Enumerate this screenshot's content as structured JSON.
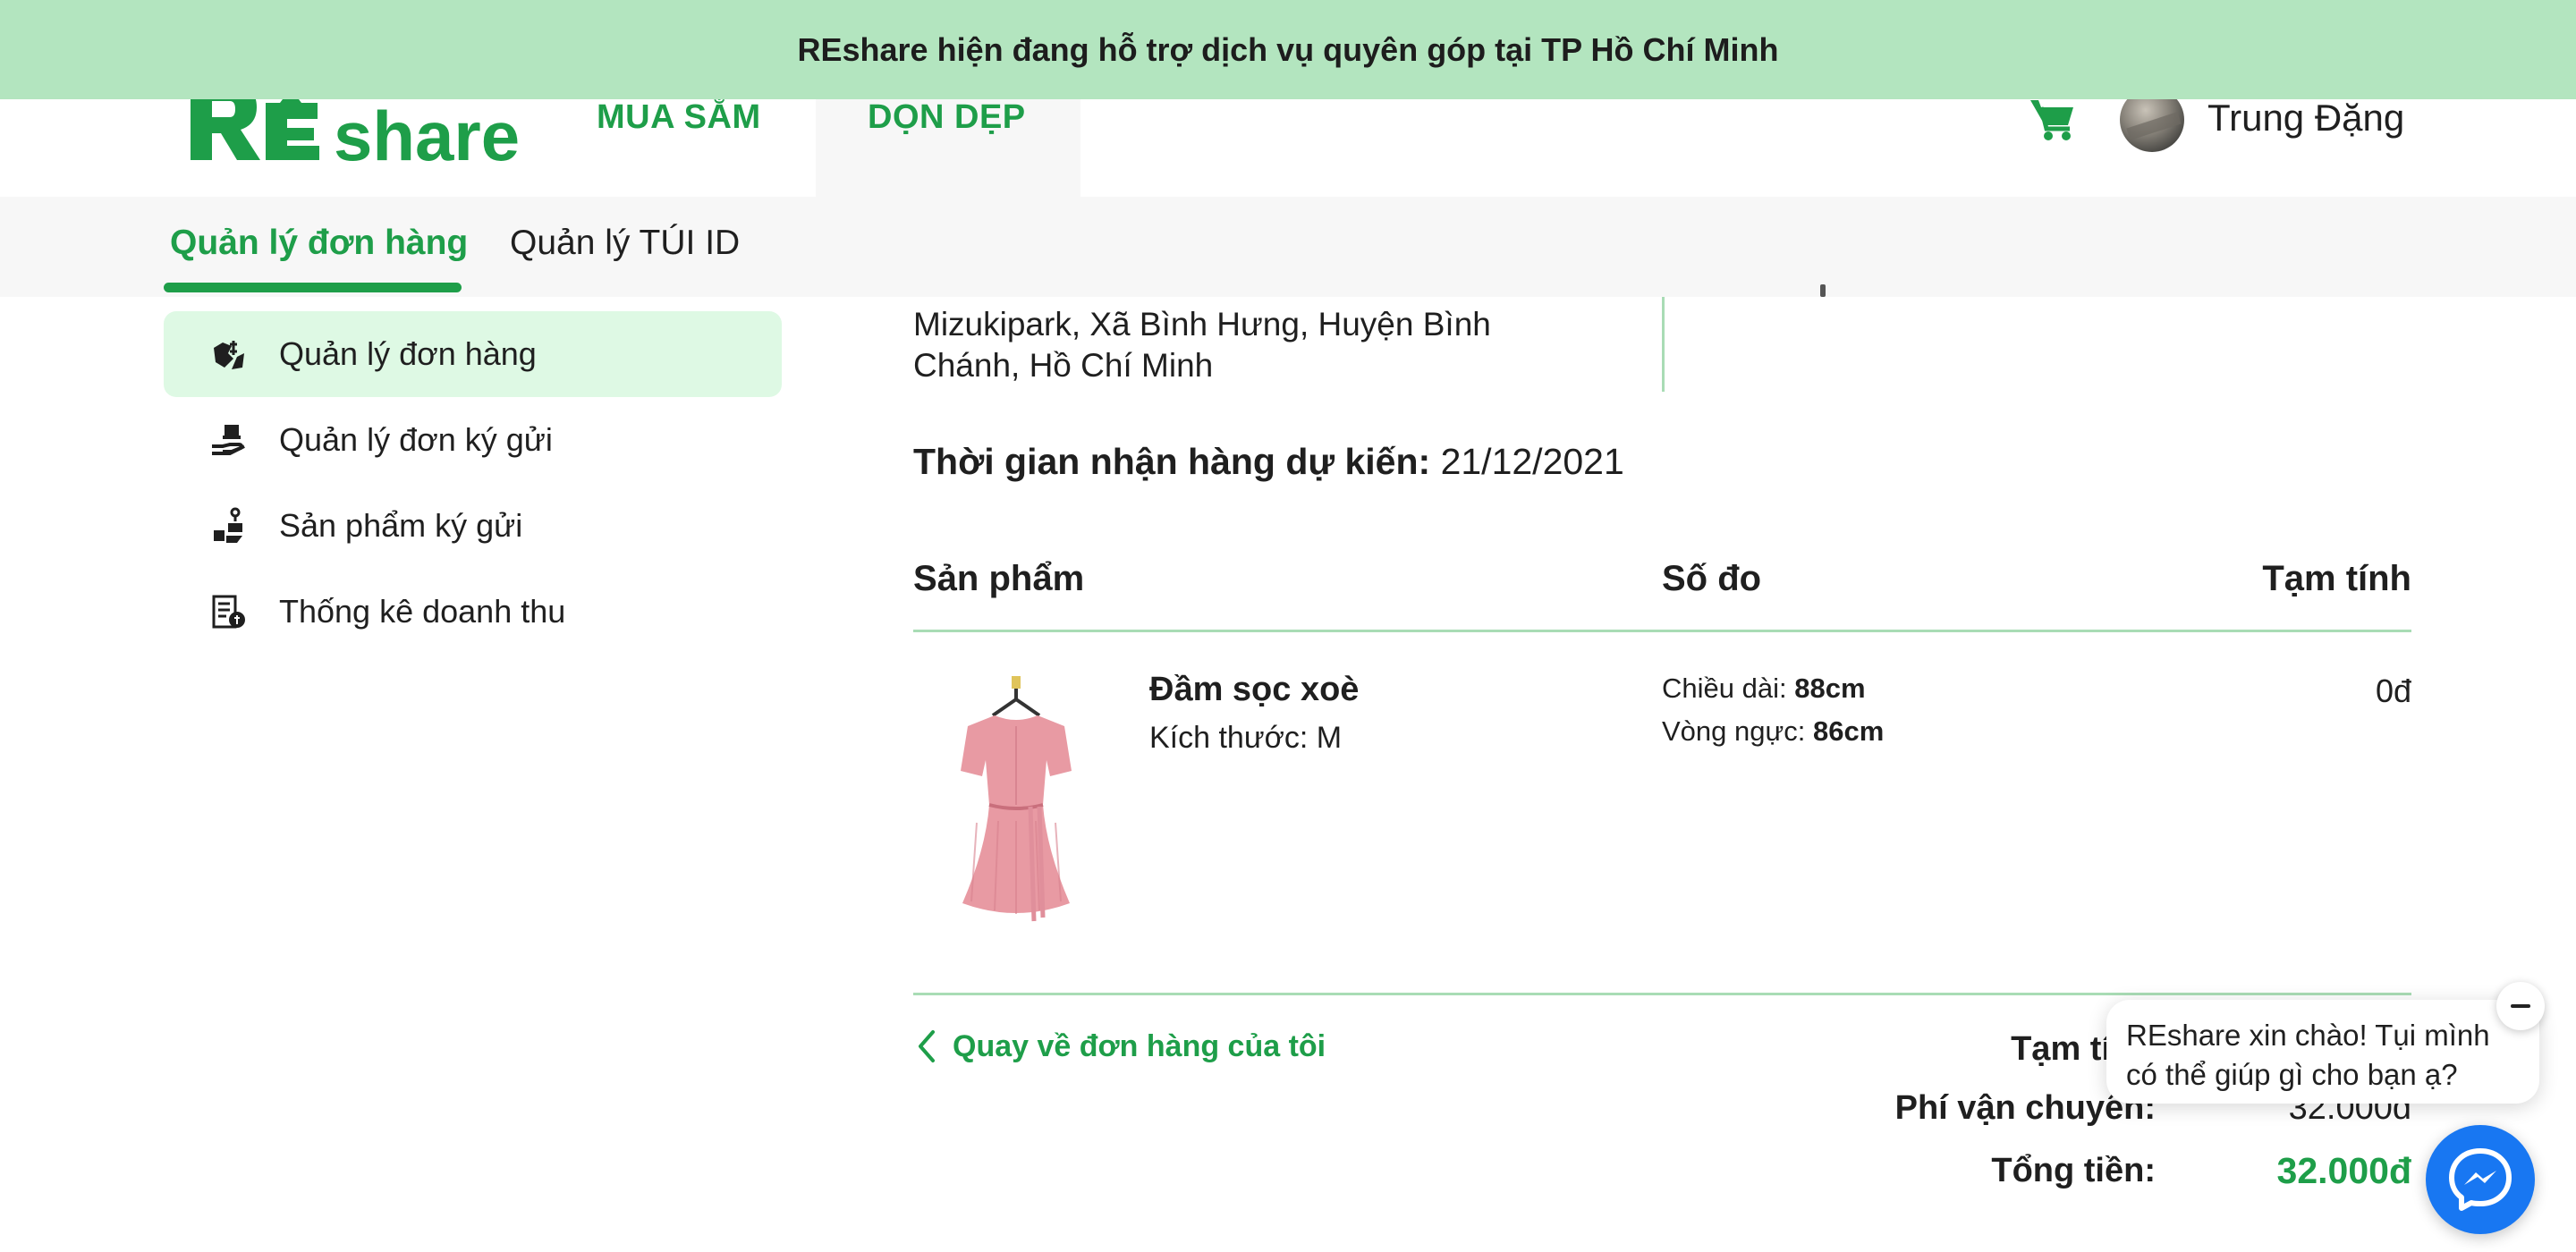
{
  "banner": {
    "text": "REshare hiện đang hỗ trợ dịch vụ quyên góp tại TP Hồ Chí Minh"
  },
  "header": {
    "logo_alt": "REshare",
    "nav": {
      "shop": "MUA SẮM",
      "clean": "DỌN DẸP"
    },
    "cart_icon": "cart-icon",
    "user_name": "Trung Đặng"
  },
  "subnav": {
    "orders": "Quản lý đơn hàng",
    "bags": "Quản lý TÚI ID"
  },
  "sidebar": {
    "items": [
      {
        "label": "Quản lý đơn hàng",
        "icon": "order-hand-icon",
        "active": true
      },
      {
        "label": "Quản lý đơn ký gửi",
        "icon": "consign-hand-icon",
        "active": false
      },
      {
        "label": "Sản phẩm ký gửi",
        "icon": "consign-product-icon",
        "active": false
      },
      {
        "label": "Thống kê doanh thu",
        "icon": "revenue-stats-icon",
        "active": false
      }
    ]
  },
  "order": {
    "address_line1": "Mizukipark, Xã Bình Hưng, Huyện Bình",
    "address_line2": "Chánh, Hồ Chí Minh",
    "eta_label": "Thời gian nhận hàng dự kiến:",
    "eta_value": "21/12/2021",
    "table": {
      "headers": {
        "product": "Sản phẩm",
        "measure": "Số đo",
        "subtotal": "Tạm tính"
      },
      "rows": [
        {
          "name": "Đầm sọc xoè",
          "size": "Kích thước: M",
          "length_label": "Chiều dài:",
          "length_value": "88cm",
          "chest_label": "Vòng ngực:",
          "chest_value": "86cm",
          "price": "0đ"
        }
      ]
    },
    "back_link": "Quay về đơn hàng của tôi",
    "summary": {
      "subtotal_label": "Tạm tí",
      "shipping_label": "Phí vận chuyển:",
      "shipping_value": "32.000đ",
      "total_label": "Tổng tiền:",
      "total_value": "32.000đ"
    }
  },
  "chat": {
    "message": "REshare xin chào! Tụi mình có thể giúp gì cho bạn ạ?",
    "close_icon": "minus-icon",
    "launcher_icon": "messenger-icon"
  },
  "colors": {
    "brand_green": "#1e9e49",
    "banner_bg": "#b3e5bf",
    "active_item_bg": "#def9e4",
    "divider": "#a9dcb5",
    "messenger_blue": "#1877f2"
  }
}
